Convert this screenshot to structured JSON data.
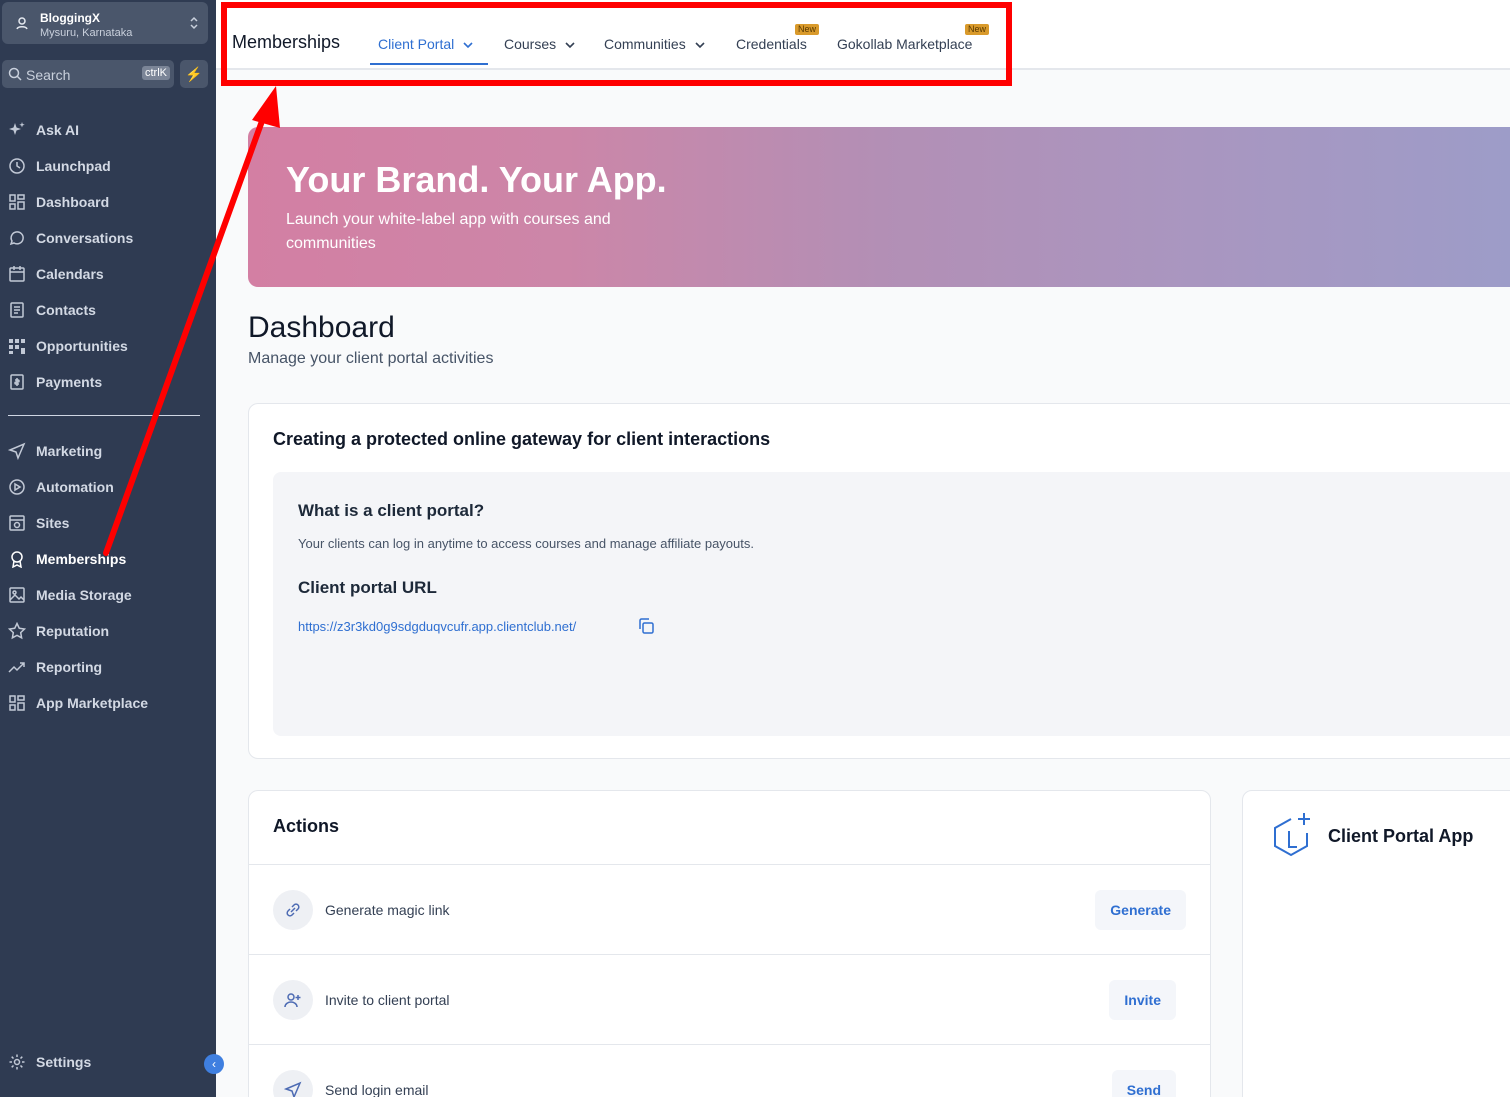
{
  "account": {
    "name": "BloggingX",
    "location": "Mysuru, Karnataka"
  },
  "search": {
    "placeholder": "Search",
    "shortcut": "ctrlK"
  },
  "sidebar": {
    "items": [
      {
        "label": "Ask AI",
        "icon": "sparkle-icon"
      },
      {
        "label": "Launchpad",
        "icon": "launchpad-icon"
      },
      {
        "label": "Dashboard",
        "icon": "grid-icon"
      },
      {
        "label": "Conversations",
        "icon": "chat-icon"
      },
      {
        "label": "Calendars",
        "icon": "calendar-icon"
      },
      {
        "label": "Contacts",
        "icon": "contacts-icon"
      },
      {
        "label": "Opportunities",
        "icon": "opportunities-icon"
      },
      {
        "label": "Payments",
        "icon": "payments-icon"
      },
      {
        "label": "Marketing",
        "icon": "send-icon"
      },
      {
        "label": "Automation",
        "icon": "automation-icon"
      },
      {
        "label": "Sites",
        "icon": "sites-icon"
      },
      {
        "label": "Memberships",
        "icon": "award-icon"
      },
      {
        "label": "Media Storage",
        "icon": "image-icon"
      },
      {
        "label": "Reputation",
        "icon": "star-icon"
      },
      {
        "label": "Reporting",
        "icon": "trend-icon"
      },
      {
        "label": "App Marketplace",
        "icon": "grid-icon"
      }
    ],
    "settings_label": "Settings"
  },
  "topnav": {
    "title": "Memberships",
    "tabs": [
      {
        "label": "Client Portal"
      },
      {
        "label": "Courses"
      },
      {
        "label": "Communities"
      },
      {
        "label": "Credentials",
        "badge": "New"
      },
      {
        "label": "Gokollab Marketplace",
        "badge": "New"
      }
    ]
  },
  "banner": {
    "heading": "Your Brand. Your App.",
    "subtitle": "Launch your white-label app with courses and communities"
  },
  "dashboard": {
    "title": "Dashboard",
    "subtitle": "Manage your client portal activities"
  },
  "gateway_card": {
    "heading": "Creating a protected online gateway for client interactions",
    "question": "What is a client portal?",
    "answer": "Your clients can log in anytime to access courses and manage affiliate payouts.",
    "url_heading": "Client portal URL",
    "url": "https://z3r3kd0g9sdgduqvcufr.app.clientclub.net/"
  },
  "actions_card": {
    "heading": "Actions",
    "rows": [
      {
        "label": "Generate magic link",
        "button": "Generate"
      },
      {
        "label": "Invite to client portal",
        "button": "Invite"
      },
      {
        "label": "Send login email",
        "button": "Send"
      }
    ]
  },
  "app_card": {
    "heading": "Client Portal App"
  },
  "colors": {
    "sidebar_bg": "#2f3b52",
    "accent": "#2f6fd1",
    "annotation": "#ff0000",
    "badge": "#d99a2b"
  }
}
